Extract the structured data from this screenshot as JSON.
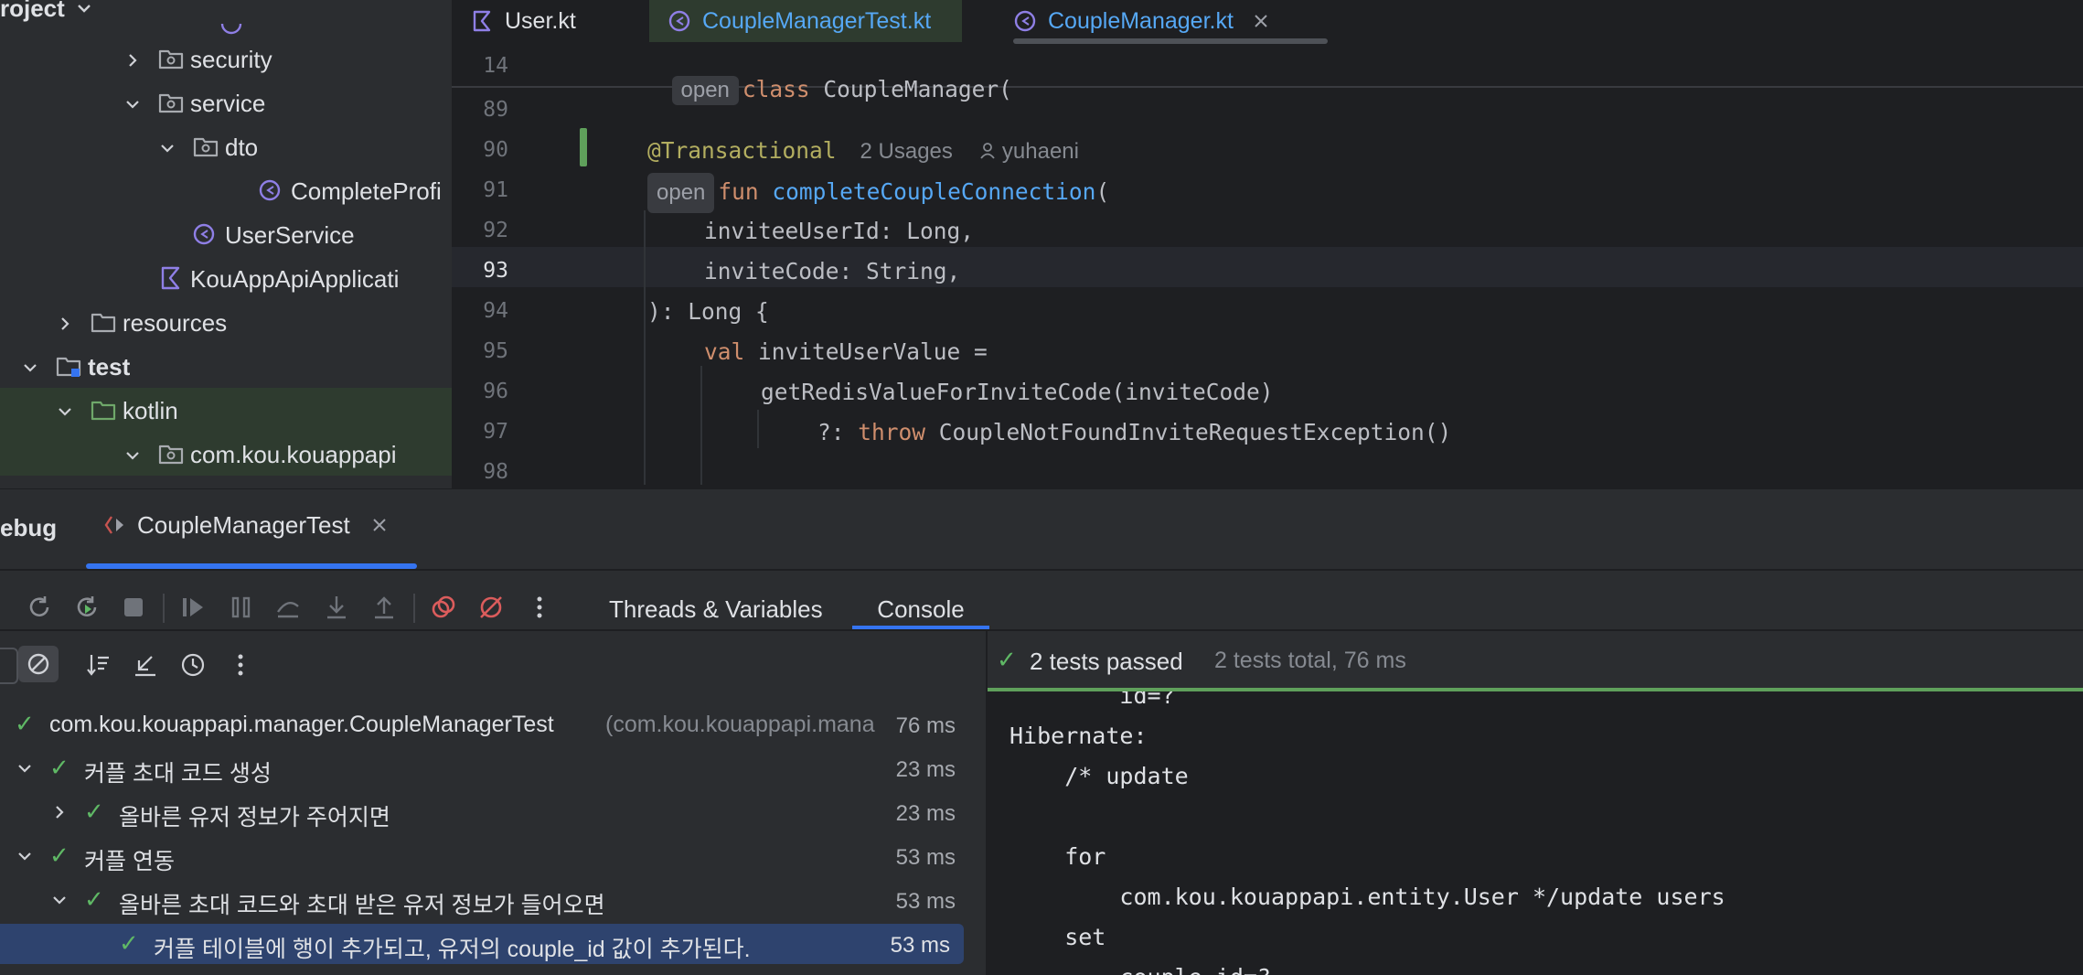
{
  "project": {
    "title": "roject",
    "tree": [
      {
        "label": "security",
        "type": "package",
        "indent": 1
      },
      {
        "label": "service",
        "type": "package",
        "indent": 1
      },
      {
        "label": "dto",
        "type": "package",
        "indent": 2
      },
      {
        "label": "CompleteProfi",
        "type": "kclass",
        "indent": 3
      },
      {
        "label": "UserService",
        "type": "kclass",
        "indent": 2
      },
      {
        "label": "KouAppApiApplicati",
        "type": "kfile",
        "indent": 1
      },
      {
        "label": "resources",
        "type": "folder",
        "indent": 0
      },
      {
        "label": "test",
        "type": "testroot",
        "indent": -1
      },
      {
        "label": "kotlin",
        "type": "folder",
        "indent": 0
      },
      {
        "label": "com.kou.kouappapi",
        "type": "package",
        "indent": 1
      }
    ]
  },
  "editor": {
    "tabs": [
      {
        "label": "User.kt",
        "active": false
      },
      {
        "label": "CoupleManagerTest.kt",
        "active": false
      },
      {
        "label": "CoupleManager.kt",
        "active": true
      }
    ],
    "sticky": {
      "line": "14",
      "chip": "open",
      "code_kw": "class",
      "code_rest": " CoupleManager("
    },
    "usages": "2 Usages",
    "author": "yuhaeni",
    "lines": [
      {
        "n": "89"
      },
      {
        "n": "90",
        "annotation": "@Transactional"
      },
      {
        "n": "91",
        "chip": "open",
        "kw": "fun",
        "fn": "completeCoupleConnection",
        "rest": "("
      },
      {
        "n": "92",
        "text": "inviteeUserId: Long,"
      },
      {
        "n": "93",
        "text": "inviteCode: String,"
      },
      {
        "n": "94",
        "text": "): Long {"
      },
      {
        "n": "95",
        "kw": "val",
        "rest": " inviteUserValue ="
      },
      {
        "n": "96",
        "text": "getRedisValueForInviteCode(inviteCode)"
      },
      {
        "n": "97",
        "pre": "?: ",
        "kw": "throw",
        "rest": " CoupleNotFoundInviteRequestException()"
      },
      {
        "n": "98"
      }
    ]
  },
  "debug": {
    "title": "ebug",
    "session_tab": "CoupleManagerTest",
    "tabs": [
      "Threads & Variables",
      "Console"
    ],
    "status": "2 tests passed",
    "status_detail": "2 tests total, 76 ms",
    "tests": [
      {
        "label": "com.kou.kouappapi.manager.CoupleManagerTest",
        "extra": " (com.kou.kouappapi.mana",
        "dur": "76 ms",
        "level": 0,
        "chev": ""
      },
      {
        "label": "커플 초대 코드 생성",
        "extra": "",
        "dur": "23 ms",
        "level": 1,
        "chev": "down"
      },
      {
        "label": "올바른 유저 정보가 주어지면",
        "extra": "",
        "dur": "23 ms",
        "level": 2,
        "chev": "right"
      },
      {
        "label": "커플 연동",
        "extra": "",
        "dur": "53 ms",
        "level": 1,
        "chev": "down"
      },
      {
        "label": "올바른 초대 코드와 초대 받은 유저 정보가 들어오면",
        "extra": "",
        "dur": "53 ms",
        "level": 2,
        "chev": "down"
      },
      {
        "label": "커플 테이블에 행이 추가되고, 유저의 couple_id 값이 추가된다.",
        "extra": "",
        "dur": "53 ms",
        "level": 3,
        "chev": "",
        "selected": true
      }
    ],
    "console": [
      "        id=?",
      "Hibernate: ",
      "    /* update",
      "",
      "    for",
      "        com.kou.kouappapi.entity.User */update users",
      "    set",
      "        couple_id=?"
    ]
  },
  "colors": {
    "accent": "#3574f0",
    "pass": "#5fb865",
    "selection": "#2e436e",
    "tree_highlight": "#2e3b2f"
  }
}
